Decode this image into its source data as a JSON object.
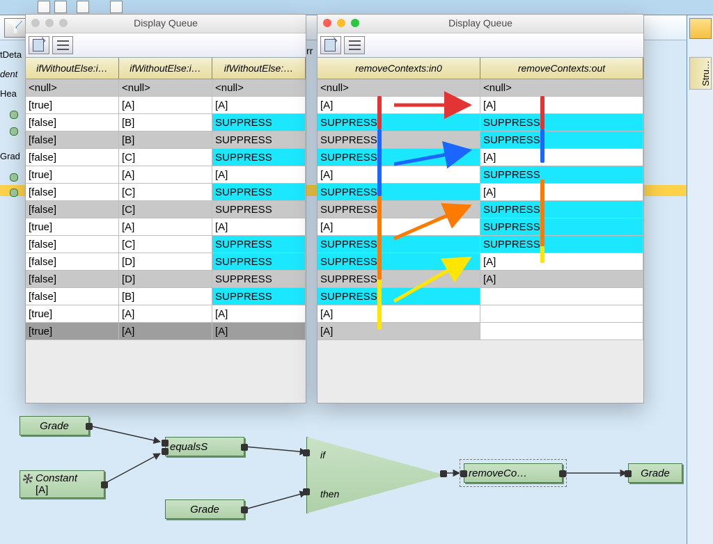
{
  "top_small_buttons_count": 4,
  "right_tab": "Stru…",
  "left_fragments": {
    "deta": "tDeta",
    "dent": "dent",
    "hea": "Hea",
    "grad": "Grad"
  },
  "left_bullets_y": [
    158,
    182,
    248,
    270
  ],
  "window_left": {
    "title": "Display Queue",
    "active": false,
    "headers": [
      "ifWithoutElse:i…",
      "ifWithoutElse:i…",
      "ifWithoutElse:…"
    ],
    "rows": [
      {
        "cells": [
          {
            "t": "<null>",
            "bg": "g"
          },
          {
            "t": "<null>",
            "bg": "g"
          },
          {
            "t": "<null>",
            "bg": "g"
          }
        ]
      },
      {
        "cells": [
          {
            "t": "[true]",
            "bg": "w"
          },
          {
            "t": "[A]",
            "bg": "w"
          },
          {
            "t": "[A]",
            "bg": "w"
          }
        ]
      },
      {
        "cells": [
          {
            "t": "[false]",
            "bg": "w"
          },
          {
            "t": "[B]",
            "bg": "w"
          },
          {
            "t": "SUPPRESS",
            "bg": "c"
          }
        ]
      },
      {
        "cells": [
          {
            "t": "[false]",
            "bg": "g"
          },
          {
            "t": "[B]",
            "bg": "g"
          },
          {
            "t": "SUPPRESS",
            "bg": "g"
          }
        ]
      },
      {
        "cells": [
          {
            "t": "[false]",
            "bg": "w"
          },
          {
            "t": "[C]",
            "bg": "w"
          },
          {
            "t": "SUPPRESS",
            "bg": "c"
          }
        ]
      },
      {
        "cells": [
          {
            "t": "[true]",
            "bg": "w"
          },
          {
            "t": "[A]",
            "bg": "w"
          },
          {
            "t": "[A]",
            "bg": "w"
          }
        ]
      },
      {
        "cells": [
          {
            "t": "[false]",
            "bg": "w"
          },
          {
            "t": "[C]",
            "bg": "w"
          },
          {
            "t": "SUPPRESS",
            "bg": "c"
          }
        ]
      },
      {
        "cells": [
          {
            "t": "[false]",
            "bg": "g"
          },
          {
            "t": "[C]",
            "bg": "g"
          },
          {
            "t": "SUPPRESS",
            "bg": "g"
          }
        ]
      },
      {
        "cells": [
          {
            "t": "[true]",
            "bg": "w"
          },
          {
            "t": "[A]",
            "bg": "w"
          },
          {
            "t": "[A]",
            "bg": "w"
          }
        ]
      },
      {
        "cells": [
          {
            "t": "[false]",
            "bg": "w"
          },
          {
            "t": "[C]",
            "bg": "w"
          },
          {
            "t": "SUPPRESS",
            "bg": "c"
          }
        ]
      },
      {
        "cells": [
          {
            "t": "[false]",
            "bg": "w"
          },
          {
            "t": "[D]",
            "bg": "w"
          },
          {
            "t": "SUPPRESS",
            "bg": "c"
          }
        ]
      },
      {
        "cells": [
          {
            "t": "[false]",
            "bg": "g"
          },
          {
            "t": "[D]",
            "bg": "g"
          },
          {
            "t": "SUPPRESS",
            "bg": "g"
          }
        ]
      },
      {
        "cells": [
          {
            "t": "[false]",
            "bg": "w"
          },
          {
            "t": "[B]",
            "bg": "w"
          },
          {
            "t": "SUPPRESS",
            "bg": "c"
          }
        ]
      },
      {
        "cells": [
          {
            "t": "[true]",
            "bg": "w"
          },
          {
            "t": "[A]",
            "bg": "w"
          },
          {
            "t": "[A]",
            "bg": "w"
          }
        ]
      },
      {
        "cells": [
          {
            "t": "[true]",
            "bg": "dd"
          },
          {
            "t": "[A]",
            "bg": "dd"
          },
          {
            "t": "[A]",
            "bg": "dd"
          }
        ]
      }
    ]
  },
  "window_right": {
    "title": "Display Queue",
    "active": true,
    "headers": [
      "removeContexts:in0",
      "removeContexts:out"
    ],
    "rows": [
      {
        "cells": [
          {
            "t": "<null>",
            "bg": "g"
          },
          {
            "t": "<null>",
            "bg": "g"
          }
        ]
      },
      {
        "cells": [
          {
            "t": "[A]",
            "bg": "w"
          },
          {
            "t": "[A]",
            "bg": "w"
          }
        ]
      },
      {
        "cells": [
          {
            "t": "SUPPRESS",
            "bg": "c"
          },
          {
            "t": "SUPPRESS",
            "bg": "c"
          }
        ]
      },
      {
        "cells": [
          {
            "t": "SUPPRESS",
            "bg": "g"
          },
          {
            "t": "SUPPRESS",
            "bg": "c"
          }
        ]
      },
      {
        "cells": [
          {
            "t": "SUPPRESS",
            "bg": "c"
          },
          {
            "t": "[A]",
            "bg": "w"
          }
        ]
      },
      {
        "cells": [
          {
            "t": "[A]",
            "bg": "w"
          },
          {
            "t": "SUPPRESS",
            "bg": "c"
          }
        ]
      },
      {
        "cells": [
          {
            "t": "SUPPRESS",
            "bg": "c"
          },
          {
            "t": "[A]",
            "bg": "w"
          }
        ]
      },
      {
        "cells": [
          {
            "t": "SUPPRESS",
            "bg": "g"
          },
          {
            "t": "SUPPRESS",
            "bg": "c"
          }
        ]
      },
      {
        "cells": [
          {
            "t": "[A]",
            "bg": "w"
          },
          {
            "t": "SUPPRESS",
            "bg": "c"
          }
        ]
      },
      {
        "cells": [
          {
            "t": "SUPPRESS",
            "bg": "c"
          },
          {
            "t": "SUPPRESS",
            "bg": "c"
          }
        ]
      },
      {
        "cells": [
          {
            "t": "SUPPRESS",
            "bg": "c"
          },
          {
            "t": "[A]",
            "bg": "w"
          }
        ]
      },
      {
        "cells": [
          {
            "t": "SUPPRESS",
            "bg": "g"
          },
          {
            "t": "[A]",
            "bg": "g"
          }
        ]
      },
      {
        "cells": [
          {
            "t": "SUPPRESS",
            "bg": "c"
          },
          {
            "t": "",
            "bg": "w"
          }
        ]
      },
      {
        "cells": [
          {
            "t": "[A]",
            "bg": "w"
          },
          {
            "t": "",
            "bg": "w"
          }
        ]
      },
      {
        "cells": [
          {
            "t": "[A]",
            "bg": "g"
          },
          {
            "t": "",
            "bg": "w"
          }
        ]
      }
    ]
  },
  "between_frag": "rr",
  "graph": {
    "nodes": {
      "grade_in": "Grade",
      "constant": "Constant",
      "constant_val": "[A]",
      "equalsS": "equalsS",
      "grade_mid": "Grade",
      "if": "if",
      "then": "then",
      "removeCo": "removeCo…",
      "grade_out": "Grade"
    }
  }
}
